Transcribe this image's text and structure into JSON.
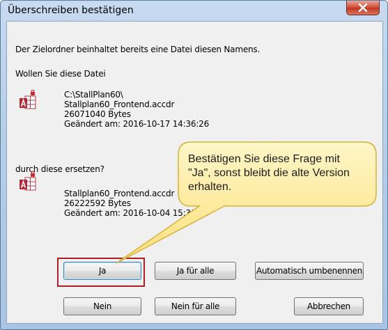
{
  "dialog": {
    "title": "Überschreiben bestätigen",
    "intro": "Der Zielordner beinhaltet bereits eine Datei diesen Namens.",
    "question": "Wollen Sie diese Datei",
    "existing": {
      "path": "C:\\StallPlan60\\",
      "name": "Stallplan60_Frontend.accdr",
      "size": "26071040 Bytes",
      "modified": "Geändert am: 2016-10-17 14:36:26"
    },
    "replace_label": "durch diese ersetzen?",
    "new": {
      "name": "Stallplan60_Frontend.accdr",
      "size": "26222592 Bytes",
      "modified": "Geändert am: 2016-10-04 15:30:06"
    },
    "buttons": {
      "yes": "Ja",
      "yes_all": "Ja für alle",
      "auto_rename": "Automatisch umbenennen",
      "no": "Nein",
      "no_all": "Nein für alle",
      "cancel": "Abbrechen"
    }
  },
  "callout": {
    "text": "Bestätigen Sie diese Frage mit \"Ja\", sonst bleibt die alte Version erhalten."
  },
  "icons": {
    "file_icon": "access-file-icon",
    "close_icon": "close-icon"
  },
  "colors": {
    "highlight_border": "#b01e27",
    "callout_fill": "#fde88c",
    "close_button": "#c9442d"
  }
}
